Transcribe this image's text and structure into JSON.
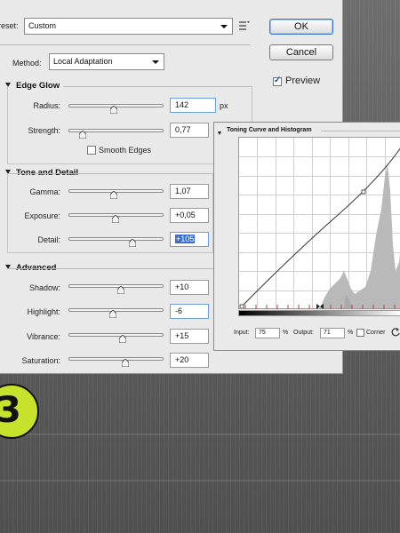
{
  "dialog": {
    "preset_label": "reset:",
    "preset_value": "Custom",
    "method_label": "Method:",
    "method_value": "Local Adaptation",
    "ok_label": "OK",
    "cancel_label": "Cancel",
    "preview_label": "Preview",
    "preview_checked": true
  },
  "edge_glow": {
    "title": "Edge Glow",
    "radius": {
      "label": "Radius:",
      "value": "142",
      "unit": "px",
      "level": 0.5
    },
    "strength": {
      "label": "Strength:",
      "value": "0,77",
      "level": 0.15
    },
    "smooth_edges_label": "Smooth Edges",
    "smooth_edges_checked": false
  },
  "tone_detail": {
    "title": "Tone and Detail",
    "gamma": {
      "label": "Gamma:",
      "value": "1,07",
      "level": 0.48
    },
    "exposure": {
      "label": "Exposure:",
      "value": "+0,05",
      "level": 0.5
    },
    "detail": {
      "label": "Detail:",
      "value": "+105",
      "level": 0.67
    }
  },
  "advanced": {
    "title": "Advanced",
    "shadow": {
      "label": "Shadow:",
      "value": "+10",
      "level": 0.55
    },
    "highlight": {
      "label": "Highlight:",
      "value": "-6",
      "level": 0.47
    },
    "vibrance": {
      "label": "Vibrance:",
      "value": "+15",
      "level": 0.57
    },
    "saturation": {
      "label": "Saturation:",
      "value": "+20",
      "level": 0.6
    }
  },
  "curve": {
    "title": "Toning Curve and Histogram",
    "input_label": "Input:",
    "input_value": "75",
    "input_unit": "%",
    "output_label": "Output:",
    "output_value": "71",
    "output_unit": "%",
    "corner_label": "Corner",
    "corner_checked": false
  },
  "badge": {
    "text": "3",
    "color": "#c6e22a"
  }
}
